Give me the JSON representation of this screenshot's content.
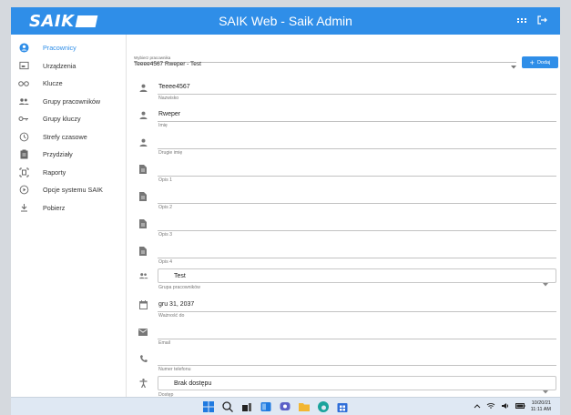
{
  "app": {
    "logo_text": "SAIK",
    "title": "SAIK Web - Saik Admin",
    "icons": [
      "apps-icon",
      "logout-icon"
    ]
  },
  "sidebar": {
    "items": [
      {
        "label": "Pracownicy",
        "icon": "person-circle-icon",
        "active": true
      },
      {
        "label": "Urządzenia",
        "icon": "device-icon",
        "active": false
      },
      {
        "label": "Klucze",
        "icon": "keys-icon",
        "active": false
      },
      {
        "label": "Grupy pracowników",
        "icon": "people-icon",
        "active": false
      },
      {
        "label": "Grupy kluczy",
        "icon": "key-icon",
        "active": false
      },
      {
        "label": "Strefy czasowe",
        "icon": "clock-icon",
        "active": false
      },
      {
        "label": "Przydziały",
        "icon": "clipboard-icon",
        "active": false
      },
      {
        "label": "Raporty",
        "icon": "report-icon",
        "active": false
      },
      {
        "label": "Opcje systemu SAIK",
        "icon": "play-circle-icon",
        "active": false
      },
      {
        "label": "Pobierz",
        "icon": "download-icon",
        "active": false
      }
    ]
  },
  "selector": {
    "label": "Wybierz pracownika",
    "value": "Teeee4567 Rweper - Test"
  },
  "add_button": {
    "label": "Dodaj"
  },
  "form": {
    "surname": {
      "value": "Teeee4567",
      "label": "Nazwisko"
    },
    "first_name": {
      "value": "Rweper",
      "label": "Imię"
    },
    "second_name": {
      "value": "",
      "label": "Drugie imię"
    },
    "desc1": {
      "value": "",
      "label": "Opis 1"
    },
    "desc2": {
      "value": "",
      "label": "Opis 2"
    },
    "desc3": {
      "value": "",
      "label": "Opis 3"
    },
    "desc4": {
      "value": "",
      "label": "Opis 4"
    },
    "group": {
      "value": "Test",
      "label": "Grupa pracowników"
    },
    "valid_to": {
      "value": "gru 31, 2037",
      "label": "Ważność do"
    },
    "email": {
      "value": "",
      "label": "Email"
    },
    "phone": {
      "value": "",
      "label": "Numer telefonu"
    },
    "access": {
      "value": "Brak dostępu",
      "label": "Dostęp"
    }
  },
  "taskbar": {
    "time": "10/20/21",
    "time2": "11:11 AM",
    "colors": {
      "windows": "#1f7ae0",
      "files": "#f2b632",
      "edge": "#1aa39c",
      "store": "#2f6ed8"
    }
  },
  "colors": {
    "accent": "#2f8ee8"
  }
}
